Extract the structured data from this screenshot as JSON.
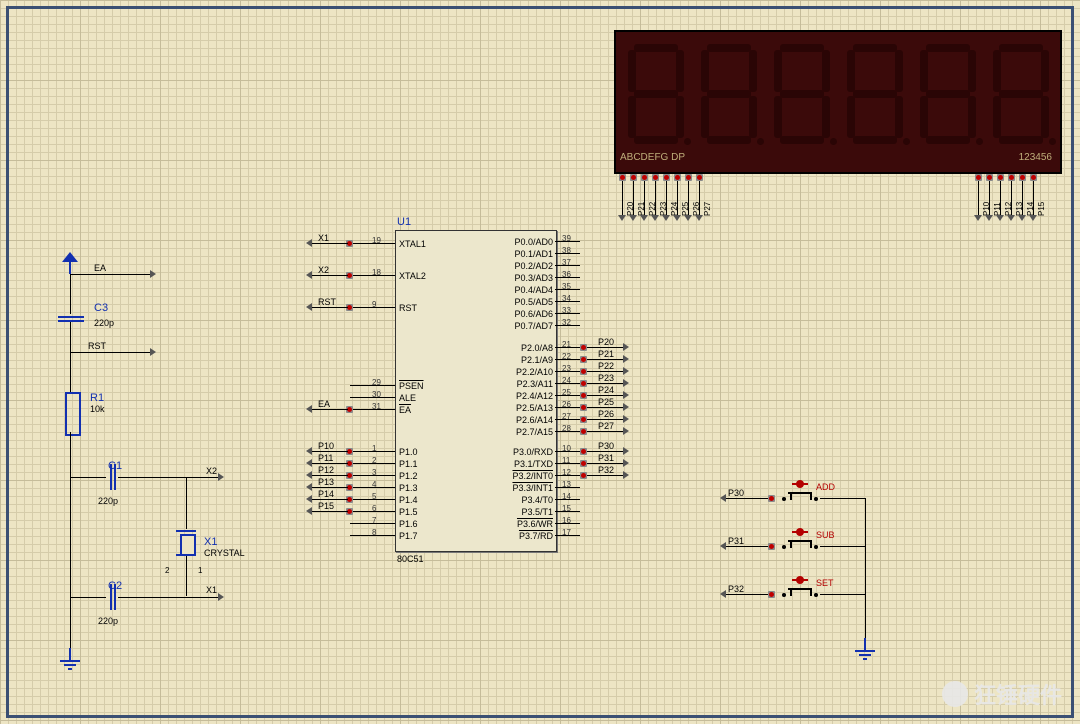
{
  "ic": {
    "ref": "U1",
    "part": "80C51",
    "left_pins": [
      {
        "num": "19",
        "name": "XTAL1",
        "net": "X1"
      },
      {
        "num": "18",
        "name": "XTAL2",
        "net": "X2"
      },
      {
        "num": "9",
        "name": "RST",
        "net": "RST"
      },
      {
        "num": "29",
        "name": "PSEN",
        "over": true
      },
      {
        "num": "30",
        "name": "ALE"
      },
      {
        "num": "31",
        "name": "EA",
        "over": true,
        "net": "EA"
      },
      {
        "num": "1",
        "name": "P1.0",
        "net": "P10"
      },
      {
        "num": "2",
        "name": "P1.1",
        "net": "P11"
      },
      {
        "num": "3",
        "name": "P1.2",
        "net": "P12"
      },
      {
        "num": "4",
        "name": "P1.3",
        "net": "P13"
      },
      {
        "num": "5",
        "name": "P1.4",
        "net": "P14"
      },
      {
        "num": "6",
        "name": "P1.5",
        "net": "P15"
      },
      {
        "num": "7",
        "name": "P1.6"
      },
      {
        "num": "8",
        "name": "P1.7"
      }
    ],
    "right_pins": [
      {
        "num": "39",
        "name": "P0.0/AD0"
      },
      {
        "num": "38",
        "name": "P0.1/AD1"
      },
      {
        "num": "37",
        "name": "P0.2/AD2"
      },
      {
        "num": "36",
        "name": "P0.3/AD3"
      },
      {
        "num": "35",
        "name": "P0.4/AD4"
      },
      {
        "num": "34",
        "name": "P0.5/AD5"
      },
      {
        "num": "33",
        "name": "P0.6/AD6"
      },
      {
        "num": "32",
        "name": "P0.7/AD7"
      },
      {
        "num": "21",
        "name": "P2.0/A8",
        "net": "P20"
      },
      {
        "num": "22",
        "name": "P2.1/A9",
        "net": "P21"
      },
      {
        "num": "23",
        "name": "P2.2/A10",
        "net": "P22"
      },
      {
        "num": "24",
        "name": "P2.3/A11",
        "net": "P23"
      },
      {
        "num": "25",
        "name": "P2.4/A12",
        "net": "P24"
      },
      {
        "num": "26",
        "name": "P2.5/A13",
        "net": "P25"
      },
      {
        "num": "27",
        "name": "P2.6/A14",
        "net": "P26"
      },
      {
        "num": "28",
        "name": "P2.7/A15",
        "net": "P27"
      },
      {
        "num": "10",
        "name": "P3.0/RXD",
        "net": "P30"
      },
      {
        "num": "11",
        "name": "P3.1/TXD",
        "net": "P31"
      },
      {
        "num": "12",
        "name": "P3.2/INT0",
        "over": true,
        "net": "P32"
      },
      {
        "num": "13",
        "name": "P3.3/INT1",
        "over": true
      },
      {
        "num": "14",
        "name": "P3.4/T0"
      },
      {
        "num": "15",
        "name": "P3.5/T1"
      },
      {
        "num": "16",
        "name": "P3.6/WR",
        "over": true
      },
      {
        "num": "17",
        "name": "P3.7/RD",
        "over": true
      }
    ]
  },
  "display": {
    "label_left": "ABCDEFG DP",
    "label_right": "123456",
    "left_nets": [
      "P20",
      "P21",
      "P22",
      "P23",
      "P24",
      "P25",
      "P26",
      "P27"
    ],
    "right_nets": [
      "P10",
      "P11",
      "P12",
      "P13",
      "P14",
      "P15"
    ]
  },
  "passives": {
    "c1": {
      "ref": "C1",
      "val": "220p"
    },
    "c2": {
      "ref": "C2",
      "val": "220p"
    },
    "c3": {
      "ref": "C3",
      "val": "220p"
    },
    "r1": {
      "ref": "R1",
      "val": "10k"
    },
    "x1": {
      "ref": "X1",
      "val": "CRYSTAL"
    }
  },
  "nets_left": {
    "ea": "EA",
    "rst": "RST",
    "x1": "X1",
    "x2": "X2"
  },
  "buttons": [
    {
      "net": "P30",
      "label": "ADD"
    },
    {
      "net": "P31",
      "label": "SUB"
    },
    {
      "net": "P32",
      "label": "SET"
    }
  ],
  "watermark": "狂锤硬件"
}
